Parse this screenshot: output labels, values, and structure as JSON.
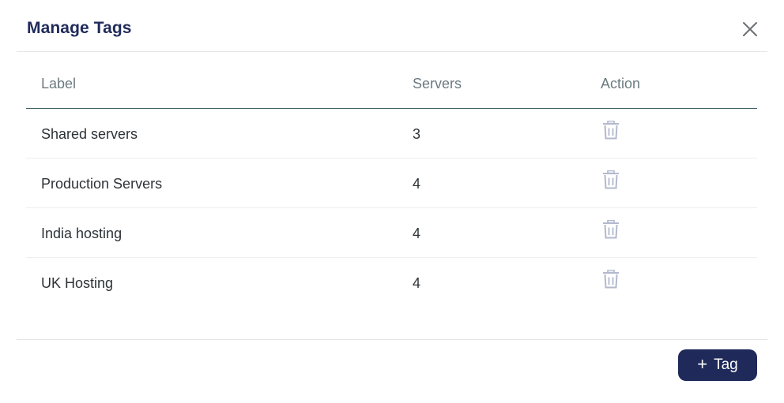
{
  "modal": {
    "title": "Manage Tags",
    "close_icon": "close-icon"
  },
  "table": {
    "headers": [
      "Label",
      "Servers",
      "Action"
    ],
    "rows": [
      {
        "label": "Shared servers",
        "servers": "3",
        "action_icon": "trash-icon"
      },
      {
        "label": "Production Servers",
        "servers": "4",
        "action_icon": "trash-icon"
      },
      {
        "label": "India hosting",
        "servers": "4",
        "action_icon": "trash-icon"
      },
      {
        "label": "UK Hosting",
        "servers": "4",
        "action_icon": "trash-icon"
      }
    ]
  },
  "footer": {
    "add_icon": "+",
    "add_label": "Tag"
  },
  "colors": {
    "primary": "#1f2a5a",
    "icon_muted": "#b3b9cd",
    "header_border": "#3f6466"
  }
}
